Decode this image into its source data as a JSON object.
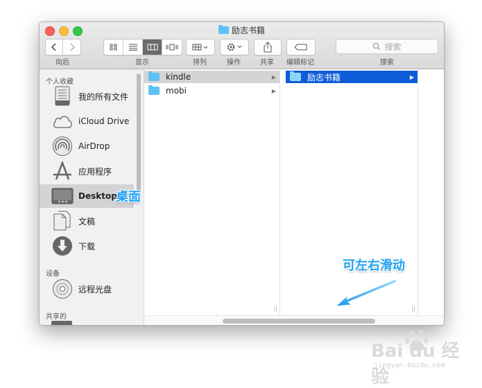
{
  "window": {
    "title": "励志书籍"
  },
  "toolbar": {
    "back_label": "向后",
    "view_label": "显示",
    "arrange_label": "排列",
    "action_label": "操作",
    "share_label": "共享",
    "tags_label": "编辑标记",
    "search_label": "搜索",
    "search_placeholder": "搜索"
  },
  "sidebar": {
    "favorites_heading": "个人收藏",
    "devices_heading": "设备",
    "shared_heading": "共享的",
    "items": [
      {
        "label": "我的所有文件",
        "icon": "all-files-icon"
      },
      {
        "label": "iCloud Drive",
        "icon": "cloud-icon"
      },
      {
        "label": "AirDrop",
        "icon": "airdrop-icon"
      },
      {
        "label": "应用程序",
        "icon": "applications-icon"
      },
      {
        "label": "Desktop",
        "icon": "desktop-icon"
      },
      {
        "label": "文稿",
        "icon": "documents-icon"
      },
      {
        "label": "下载",
        "icon": "downloads-icon"
      }
    ],
    "device_items": [
      {
        "label": "远程光盘",
        "icon": "remote-disc-icon"
      }
    ]
  },
  "columns": {
    "col1": [
      {
        "name": "kindle",
        "selected": true
      },
      {
        "name": "mobi",
        "selected": false
      }
    ],
    "col2": [
      {
        "name": "励志书籍",
        "selected": true
      }
    ]
  },
  "annotations": {
    "desktop_note": "桌面",
    "scroll_note": "可左右滑动"
  },
  "watermark": {
    "main": "Bai du 经验",
    "sub": "jingyan.baidu.com"
  },
  "colors": {
    "selection_blue": "#0f5cd7",
    "folder_blue": "#5ec2f5",
    "annotation_blue": "#1ea1f2"
  }
}
